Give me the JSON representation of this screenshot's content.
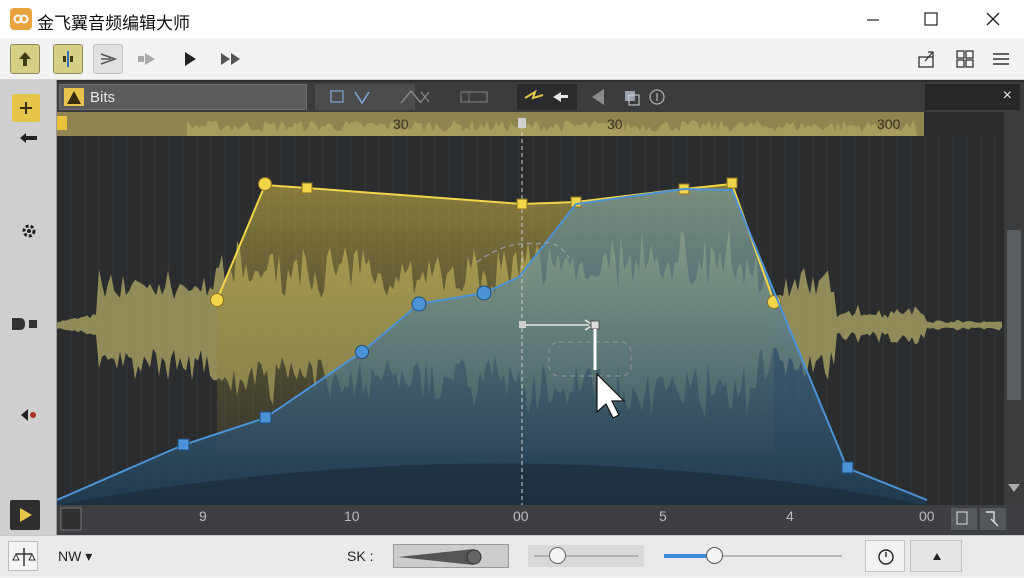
{
  "window": {
    "title": "金飞翼音频编辑大师",
    "minimize_icon": "minimize-icon",
    "maximize_icon": "maximize-icon",
    "close_icon": "close-icon"
  },
  "toolbar": {
    "left_icons": [
      "snap-up-icon",
      "split-marker-icon",
      "send-icon",
      "skip-forward-icon",
      "play-icon",
      "fast-forward-icon"
    ],
    "right_icons": [
      "export-icon",
      "layout-grid-icon",
      "menu-icon"
    ]
  },
  "track_header": {
    "name": "Bits",
    "close_label": "×"
  },
  "ruler": {
    "labels": [
      "30",
      "30",
      "300"
    ]
  },
  "timeline": {
    "labels": [
      "9",
      "10",
      "00",
      "5",
      "4",
      "00"
    ]
  },
  "bottom": {
    "mode_label": "NW ▾",
    "smoothing_label": "SK :",
    "slider_1_value": 0.22,
    "slider_2_value": 0.28
  },
  "colors": {
    "accent_yellow": "#f3d54a",
    "accent_blue": "#4b93d6",
    "waveform": "#b8b06a",
    "background": "#2b2d2f"
  }
}
